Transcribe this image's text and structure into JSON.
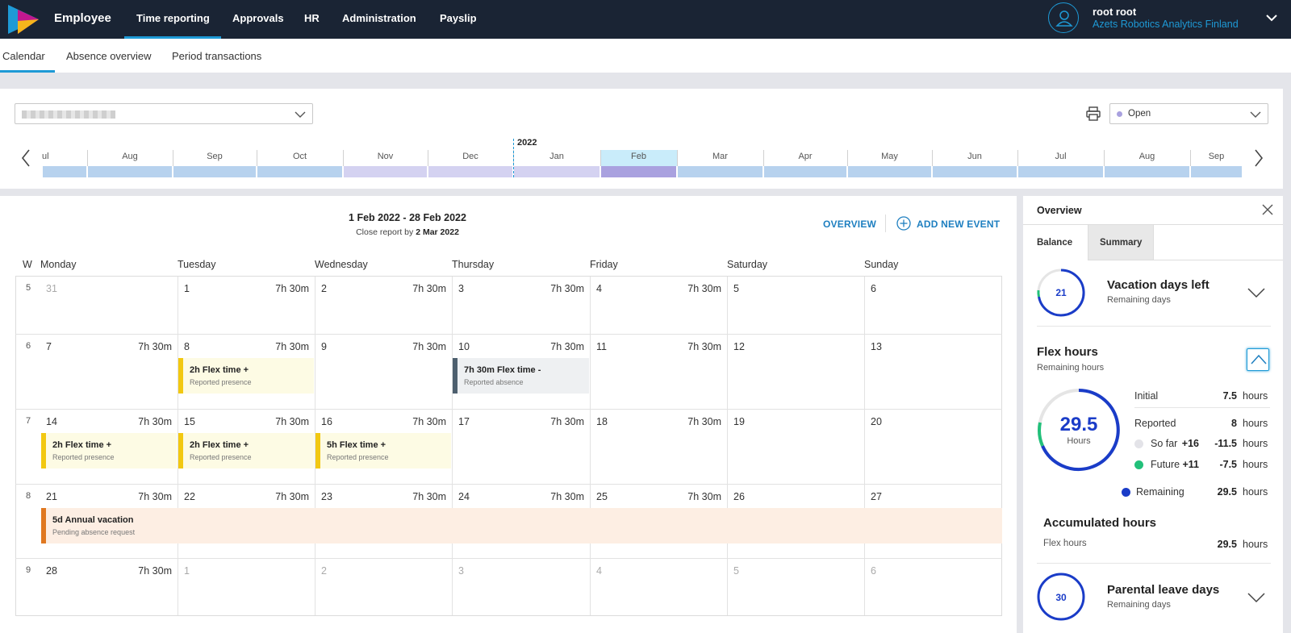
{
  "topnav": {
    "app_title": "Employee",
    "items": [
      "Time reporting",
      "Approvals",
      "HR",
      "Administration",
      "Payslip"
    ],
    "active": "Time reporting",
    "user_name": "root root",
    "user_org": "Azets Robotics Analytics Finland"
  },
  "subnav": {
    "items": [
      "Calendar",
      "Absence overview",
      "Period transactions"
    ],
    "active": "Calendar"
  },
  "filters": {
    "status_value": "Open"
  },
  "timeline": {
    "year_label": "2022",
    "months": [
      "ul",
      "Aug",
      "Sep",
      "Oct",
      "Nov",
      "Dec",
      "Jan",
      "Feb",
      "Mar",
      "Apr",
      "May",
      "Jun",
      "Jul",
      "Aug",
      "Sep"
    ],
    "selected": "Feb"
  },
  "calendar": {
    "period": "1 Feb 2022 - 28 Feb 2022",
    "close_prefix": "Close report by",
    "close_date": "2 Mar 2022",
    "overview_btn": "OVERVIEW",
    "add_event_btn": "ADD NEW EVENT",
    "week_header": "W",
    "days": [
      "Monday",
      "Tuesday",
      "Wednesday",
      "Thursday",
      "Friday",
      "Saturday",
      "Sunday"
    ],
    "weeks": [
      {
        "num": "5",
        "cells": [
          {
            "day": "31",
            "hrs": "",
            "muted": true
          },
          {
            "day": "1",
            "hrs": "7h 30m"
          },
          {
            "day": "2",
            "hrs": "7h 30m"
          },
          {
            "day": "3",
            "hrs": "7h 30m"
          },
          {
            "day": "4",
            "hrs": "7h 30m"
          },
          {
            "day": "5",
            "hrs": ""
          },
          {
            "day": "6",
            "hrs": ""
          }
        ]
      },
      {
        "num": "6",
        "cells": [
          {
            "day": "7",
            "hrs": "7h 30m"
          },
          {
            "day": "8",
            "hrs": "7h 30m"
          },
          {
            "day": "9",
            "hrs": "7h 30m"
          },
          {
            "day": "10",
            "hrs": "7h 30m"
          },
          {
            "day": "11",
            "hrs": "7h 30m"
          },
          {
            "day": "12",
            "hrs": ""
          },
          {
            "day": "13",
            "hrs": ""
          }
        ]
      },
      {
        "num": "7",
        "cells": [
          {
            "day": "14",
            "hrs": "7h 30m"
          },
          {
            "day": "15",
            "hrs": "7h 30m"
          },
          {
            "day": "16",
            "hrs": "7h 30m"
          },
          {
            "day": "17",
            "hrs": "7h 30m"
          },
          {
            "day": "18",
            "hrs": "7h 30m"
          },
          {
            "day": "19",
            "hrs": ""
          },
          {
            "day": "20",
            "hrs": ""
          }
        ]
      },
      {
        "num": "8",
        "cells": [
          {
            "day": "21",
            "hrs": "7h 30m"
          },
          {
            "day": "22",
            "hrs": "7h 30m"
          },
          {
            "day": "23",
            "hrs": "7h 30m"
          },
          {
            "day": "24",
            "hrs": "7h 30m"
          },
          {
            "day": "25",
            "hrs": "7h 30m"
          },
          {
            "day": "26",
            "hrs": ""
          },
          {
            "day": "27",
            "hrs": ""
          }
        ]
      },
      {
        "num": "9",
        "cells": [
          {
            "day": "28",
            "hrs": "7h 30m"
          },
          {
            "day": "1",
            "hrs": "",
            "muted": true
          },
          {
            "day": "2",
            "hrs": "",
            "muted": true
          },
          {
            "day": "3",
            "hrs": "",
            "muted": true
          },
          {
            "day": "4",
            "hrs": "",
            "muted": true
          },
          {
            "day": "5",
            "hrs": "",
            "muted": true
          },
          {
            "day": "6",
            "hrs": "",
            "muted": true
          }
        ]
      }
    ],
    "events": [
      {
        "week": 1,
        "day": 1,
        "span": 1,
        "title": "2h Flex time +",
        "sub": "Reported presence",
        "kind": "yellow"
      },
      {
        "week": 1,
        "day": 3,
        "span": 1,
        "title": "7h 30m Flex time -",
        "sub": "Reported absence",
        "kind": "grey"
      },
      {
        "week": 2,
        "day": 0,
        "span": 1,
        "title": "2h Flex time +",
        "sub": "Reported presence",
        "kind": "yellow"
      },
      {
        "week": 2,
        "day": 1,
        "span": 1,
        "title": "2h Flex time +",
        "sub": "Reported presence",
        "kind": "yellow"
      },
      {
        "week": 2,
        "day": 2,
        "span": 1,
        "title": "5h Flex time +",
        "sub": "Reported presence",
        "kind": "yellow"
      },
      {
        "week": 3,
        "day": 0,
        "span": 7,
        "title": "5d Annual vacation",
        "sub": "Pending absence request",
        "kind": "orange"
      }
    ]
  },
  "overview": {
    "title": "Overview",
    "tabs": [
      "Balance",
      "Summary"
    ],
    "active_tab": "Balance",
    "vacation": {
      "value": "21",
      "title": "Vacation days left",
      "sub": "Remaining days"
    },
    "flex": {
      "title": "Flex hours",
      "sub": "Remaining hours",
      "value": "29.5",
      "unit_label": "Hours",
      "initial_label": "Initial",
      "initial_val": "7.5",
      "reported_label": "Reported",
      "reported_val": "8",
      "sofar_label": "So far",
      "sofar_a": "+16",
      "sofar_b": "-11.5",
      "future_label": "Future",
      "future_a": "+11",
      "future_b": "-7.5",
      "remaining_label": "Remaining",
      "remaining_val": "29.5",
      "unit": "hours"
    },
    "accumulated": {
      "title": "Accumulated hours",
      "label": "Flex hours",
      "val": "29.5",
      "unit": "hours"
    },
    "parental": {
      "value": "30",
      "title": "Parental leave days",
      "sub": "Remaining days"
    }
  },
  "colors": {
    "accent": "#1e9ad6",
    "nav_bg": "#1a2434",
    "ring": "#1a3cc8",
    "green": "#22c07a"
  }
}
